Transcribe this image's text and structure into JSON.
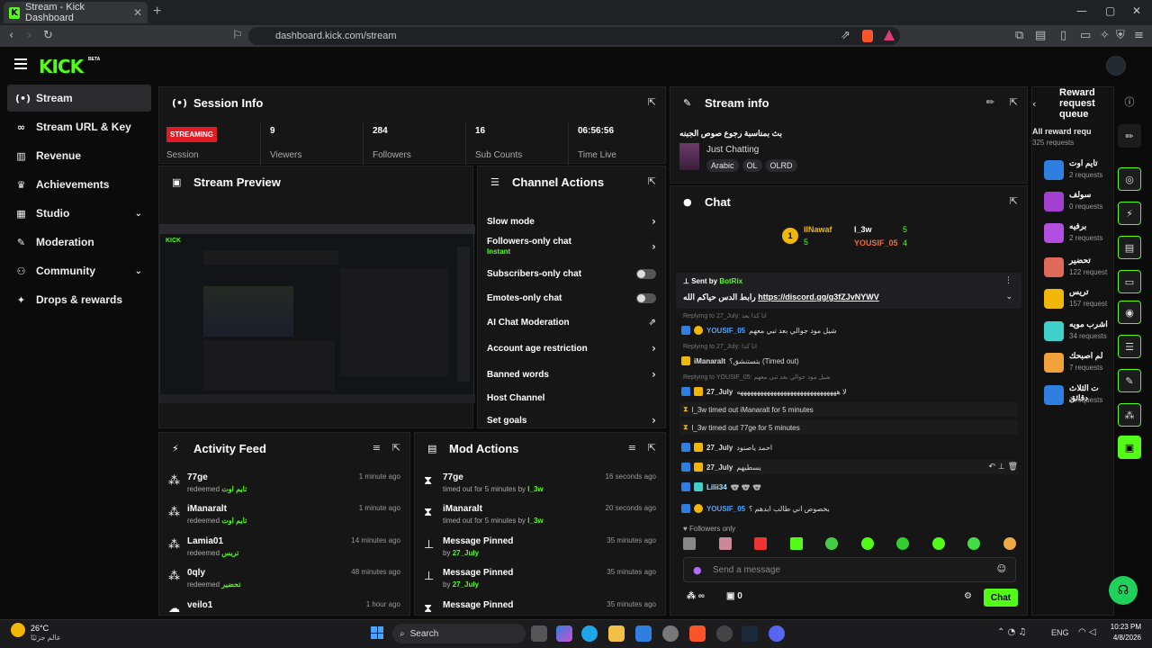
{
  "browser": {
    "tab_title": "Stream - Kick Dashboard",
    "url": "dashboard.kick.com/stream",
    "tab_close": "✕",
    "new_tab": "+",
    "win_controls": [
      "—",
      "▢",
      "✕"
    ]
  },
  "app": {
    "logo": "KICK",
    "beta": "BETA"
  },
  "sidebar": {
    "items": [
      {
        "label": "Stream",
        "icon": "stream-icon",
        "active": true
      },
      {
        "label": "Stream URL & Key",
        "icon": "link-icon"
      },
      {
        "label": "Revenue",
        "icon": "revenue-icon"
      },
      {
        "label": "Achievements",
        "icon": "trophy-icon"
      },
      {
        "label": "Studio",
        "icon": "studio-icon",
        "chevron": true
      },
      {
        "label": "Moderation",
        "icon": "wrench-icon"
      },
      {
        "label": "Community",
        "icon": "community-icon",
        "chevron": true
      },
      {
        "label": "Drops & rewards",
        "icon": "gift-icon"
      }
    ]
  },
  "session": {
    "title": "Session Info",
    "badge": "STREAMING",
    "badge_label": "Session",
    "stats": [
      {
        "value": "9",
        "label": "Viewers"
      },
      {
        "value": "284",
        "label": "Followers"
      },
      {
        "value": "16",
        "label": "Sub Counts"
      },
      {
        "value": "06:56:56",
        "label": "Time Live"
      }
    ]
  },
  "preview": {
    "title": "Stream Preview"
  },
  "channel_actions": {
    "title": "Channel Actions",
    "rows": [
      {
        "label": "Slow mode",
        "control": "arrow"
      },
      {
        "label": "Followers-only chat",
        "sub": "Instant",
        "control": "arrow"
      },
      {
        "label": "Subscribers-only chat",
        "control": "toggle"
      },
      {
        "label": "Emotes-only chat",
        "control": "toggle"
      },
      {
        "label": "AI Chat Moderation",
        "control": "external"
      },
      {
        "label": "Account age restriction",
        "control": "arrow"
      },
      {
        "label": "Banned words",
        "control": "arrow"
      },
      {
        "label": "Host Channel",
        "control": "none"
      },
      {
        "label": "Set goals",
        "control": "arrow"
      }
    ]
  },
  "stream_info": {
    "title": "Stream info",
    "stream_title": "بث بمناسبة رجوع صوص الجبنه",
    "category": "Just Chatting",
    "tags": [
      "Arabic",
      "OL",
      "OLRD"
    ]
  },
  "chat": {
    "title": "Chat",
    "leaders": [
      {
        "name": "lINawaf",
        "count": "5"
      },
      {
        "name": "l_3w",
        "count": "5"
      },
      {
        "name": "YOUSIF_05",
        "count": "4"
      }
    ],
    "rank": "1",
    "pinned": {
      "sent_by": "Sent by",
      "sender": "BotRix",
      "text": "رابط الدس حياكم الله",
      "link": "https://discord.gg/g3fZJvNYWV"
    },
    "messages": [
      {
        "reply": "Replying to 27_July: انا كذا بعد",
        "user": "YOUSIF_05",
        "user_color": "#4ea3ff",
        "text": "شيل مود جوالي بعد تبي معهم"
      },
      {
        "reply": "Replying to 27_July: انا كذا",
        "user": "iManaralt",
        "user_color": "#fff",
        "text": "بتستنشق؟ (Timed out)"
      },
      {
        "reply": "Replying to YOUSIF_05: شيل مود جوالي بعد تبي معهم",
        "user": "27_July",
        "user_color": "#fff",
        "text": "لا ههههههههههههههههههههههههههههههه"
      },
      {
        "system": true,
        "text": "l_3w timed out iManaralt for 5 minutes"
      },
      {
        "system": true,
        "text": "l_3w timed out 77ge for 5 minutes"
      },
      {
        "user": "27_July",
        "user_color": "#fff",
        "text": "احمد ياصنود"
      },
      {
        "user": "27_July",
        "user_color": "#fff",
        "text": "يسطيهم"
      },
      {
        "user": "Lilii34",
        "user_color": "#a8e6ff",
        "text": "🐨 🐨 🐨"
      },
      {
        "user": "YOUSIF_05",
        "user_color": "#4ea3ff",
        "text": "بخصوص اني طالب ابدهم ؟"
      }
    ],
    "followers_only": "Followers only",
    "input_placeholder": "Send a message",
    "points": "∞",
    "gifts": "0",
    "send": "Chat"
  },
  "activity": {
    "title": "Activity Feed",
    "items": [
      {
        "name": "77ge",
        "action": "redeemed",
        "reward": "تايم اوت",
        "time": "1 minute ago"
      },
      {
        "name": "iManaralt",
        "action": "redeemed",
        "reward": "تايم اوت",
        "time": "1 minute ago"
      },
      {
        "name": "Lamia01",
        "action": "redeemed",
        "reward": "تريس",
        "time": "14 minutes ago"
      },
      {
        "name": "0qly",
        "action": "redeemed",
        "reward": "تحضير",
        "time": "48 minutes ago"
      },
      {
        "name": "veilo1",
        "action": "",
        "reward": "",
        "time": "1 hour ago"
      }
    ]
  },
  "mod": {
    "title": "Mod Actions",
    "items": [
      {
        "name": "77ge",
        "action": "timed out for 5 minutes by",
        "by": "l_3w",
        "time": "16 seconds ago"
      },
      {
        "name": "iManaralt",
        "action": "timed out for 5 minutes by",
        "by": "l_3w",
        "time": "20 seconds ago"
      },
      {
        "name": "Message Pinned",
        "action": "by",
        "by": "27_July",
        "time": "35 minutes ago"
      },
      {
        "name": "Message Pinned",
        "action": "by",
        "by": "27_July",
        "time": "35 minutes ago"
      },
      {
        "name": "Message Pinned",
        "action": "",
        "by": "",
        "time": "35 minutes ago"
      }
    ]
  },
  "rewards": {
    "title": "Reward request queue",
    "all": "All reward requ",
    "count": "325 requests",
    "items": [
      {
        "name": "تايم اوت",
        "count": "2 requests",
        "color": "#2f7fe0"
      },
      {
        "name": "سولف",
        "count": "0 requests",
        "color": "#a33fd1"
      },
      {
        "name": "برفيه",
        "count": "2 requests",
        "color": "#b24fe0"
      },
      {
        "name": "تحضير",
        "count": "122 request",
        "color": "#e06a5a"
      },
      {
        "name": "تريس",
        "count": "157 request",
        "color": "#f2b705"
      },
      {
        "name": "اشرب مويه",
        "count": "34 requests",
        "color": "#3fd1c9"
      },
      {
        "name": "لم اصبحك",
        "count": "7 requests",
        "color": "#f2a23a"
      },
      {
        "name": "ت الثلاث دقائق",
        "count": "1 requests",
        "color": "#2f7fe0"
      }
    ]
  },
  "taskbar": {
    "weather_temp": "26°C",
    "weather_place": "عالم جزئيًا",
    "search": "Search",
    "lang": "ENG",
    "time": "10:23 PM",
    "date": "4/8/2026"
  }
}
